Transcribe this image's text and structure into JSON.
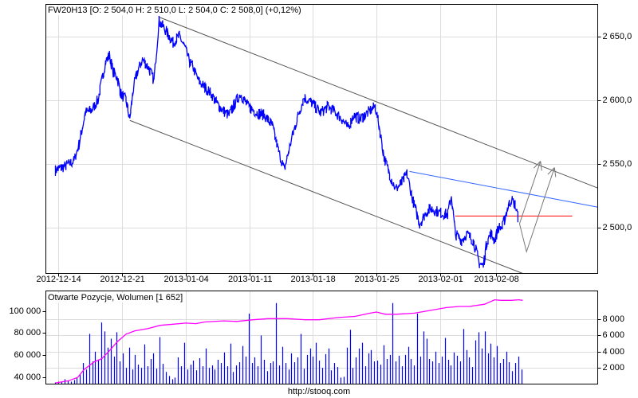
{
  "header": {
    "title": "FW20H13 [O: 2 504,0  H: 2 510,0  L: 2 504,0  C: 2 508,0] (+0,12%)"
  },
  "footer": {
    "url": "http://stooq.com"
  },
  "colors": {
    "price": "#0000ff",
    "trend": "#555555",
    "blue_trend": "#3366ff",
    "level": "#ff0000",
    "oi": "#ff00ff",
    "volume": "#0000ff",
    "grid": "#dddddd"
  },
  "chart_data": [
    {
      "type": "line",
      "title": "FW20H13",
      "x_unit": "session",
      "xlim": [
        0,
        43.4
      ],
      "ylim": [
        2464,
        2675
      ],
      "grid": true,
      "x_ticks": [
        {
          "x": 1,
          "label": "2012-12-14"
        },
        {
          "x": 6,
          "label": "2012-12-21"
        },
        {
          "x": 11,
          "label": "2013-01-04"
        },
        {
          "x": 16,
          "label": "2013-01-11"
        },
        {
          "x": 21,
          "label": "2013-01-18"
        },
        {
          "x": 26,
          "label": "2013-01-25"
        },
        {
          "x": 31,
          "label": "2013-02-01"
        },
        {
          "x": 35.4,
          "label": "2013-02-08"
        }
      ],
      "y_ticks": [
        {
          "y": 2650,
          "label": "2 650,0"
        },
        {
          "y": 2600,
          "label": "2 600,0"
        },
        {
          "y": 2550,
          "label": "2 550,0"
        },
        {
          "y": 2500,
          "label": "2 500,0"
        }
      ],
      "price": [
        [
          0.75,
          2545
        ],
        [
          1.5,
          2548
        ],
        [
          2.2,
          2552
        ],
        [
          2.6,
          2565
        ],
        [
          3.1,
          2590
        ],
        [
          3.6,
          2592
        ],
        [
          4.1,
          2600
        ],
        [
          4.4,
          2615
        ],
        [
          4.7,
          2630
        ],
        [
          5.0,
          2635
        ],
        [
          5.3,
          2622
        ],
        [
          5.6,
          2618
        ],
        [
          5.9,
          2605
        ],
        [
          6.3,
          2600
        ],
        [
          6.6,
          2585
        ],
        [
          6.9,
          2610
        ],
        [
          7.2,
          2622
        ],
        [
          7.6,
          2632
        ],
        [
          8.1,
          2625
        ],
        [
          8.5,
          2615
        ],
        [
          8.9,
          2662
        ],
        [
          9.4,
          2655
        ],
        [
          10,
          2645
        ],
        [
          10.5,
          2650
        ],
        [
          10.9,
          2642
        ],
        [
          11.3,
          2630
        ],
        [
          11.6,
          2625
        ],
        [
          12.0,
          2615
        ],
        [
          12.5,
          2610
        ],
        [
          13.0,
          2605
        ],
        [
          13.4,
          2598
        ],
        [
          13.9,
          2592
        ],
        [
          14.4,
          2588
        ],
        [
          14.9,
          2598
        ],
        [
          15.3,
          2605
        ],
        [
          15.9,
          2595
        ],
        [
          16.6,
          2590
        ],
        [
          17.2,
          2588
        ],
        [
          17.8,
          2580
        ],
        [
          18.3,
          2560
        ],
        [
          18.75,
          2545
        ],
        [
          19.1,
          2560
        ],
        [
          19.4,
          2572
        ],
        [
          19.9,
          2590
        ],
        [
          20.3,
          2602
        ],
        [
          20.9,
          2598
        ],
        [
          21.6,
          2590
        ],
        [
          22.2,
          2595
        ],
        [
          22.8,
          2590
        ],
        [
          23.3,
          2585
        ],
        [
          23.75,
          2578
        ],
        [
          24.2,
          2588
        ],
        [
          24.7,
          2585
        ],
        [
          25.3,
          2590
        ],
        [
          25.9,
          2595
        ],
        [
          26.2,
          2580
        ],
        [
          26.6,
          2555
        ],
        [
          27.1,
          2540
        ],
        [
          27.5,
          2530
        ],
        [
          28.0,
          2535
        ],
        [
          28.4,
          2542
        ],
        [
          28.9,
          2520
        ],
        [
          29.4,
          2503
        ],
        [
          29.9,
          2512
        ],
        [
          30.3,
          2515
        ],
        [
          30.9,
          2512
        ],
        [
          31.6,
          2510
        ],
        [
          31.9,
          2525
        ],
        [
          32.2,
          2495
        ],
        [
          32.7,
          2490
        ],
        [
          33.1,
          2495
        ],
        [
          33.6,
          2490
        ],
        [
          34.1,
          2472
        ],
        [
          34.4,
          2470
        ],
        [
          34.7,
          2490
        ],
        [
          35.0,
          2495
        ],
        [
          35.3,
          2490
        ],
        [
          35.6,
          2500
        ],
        [
          35.9,
          2500
        ],
        [
          36.3,
          2515
        ],
        [
          36.6,
          2522
        ],
        [
          36.9,
          2518
        ],
        [
          37.2,
          2505
        ]
      ],
      "trend_lines": [
        {
          "name": "upper-channel",
          "from": [
            8.9,
            2665
          ],
          "to": [
            43.4,
            2531
          ]
        },
        {
          "name": "lower-channel",
          "from": [
            6.6,
            2584
          ],
          "to": [
            37.5,
            2464
          ]
        },
        {
          "name": "blue-resistance",
          "from": [
            28.6,
            2544
          ],
          "to": [
            43.4,
            2516
          ]
        },
        {
          "name": "red-level",
          "from": [
            32.2,
            2509
          ],
          "to": [
            41.4,
            2509
          ]
        }
      ],
      "forecast_arrows": [
        [
          [
            37.25,
            2503
          ],
          [
            38.9,
            2552
          ]
        ],
        [
          [
            37.25,
            2503
          ],
          [
            37.8,
            2481
          ],
          [
            40.0,
            2547
          ]
        ]
      ]
    },
    {
      "type": "bar",
      "title": "Otwarte Pozycje, Wolumen [1 652]",
      "xlim": [
        0,
        43.4
      ],
      "x_start": 0.75,
      "x_end": 37.4,
      "y_left": {
        "label": "Otwarte Pozycje",
        "ylim": [
          34000,
          118000
        ],
        "ticks": [
          {
            "y": 100000,
            "label": "100 000"
          },
          {
            "y": 80000,
            "label": "80 000"
          },
          {
            "y": 60000,
            "label": "60 000"
          },
          {
            "y": 40000,
            "label": "40 000"
          }
        ]
      },
      "y_right": {
        "label": "Wolumen",
        "ylim": [
          0,
          11500
        ],
        "ticks": [
          {
            "y": 8000,
            "label": "8 000"
          },
          {
            "y": 6000,
            "label": "6 000"
          },
          {
            "y": 4000,
            "label": "4 000"
          },
          {
            "y": 2000,
            "label": "2 000"
          }
        ]
      },
      "volume": [
        200,
        300,
        250,
        600,
        400,
        300,
        500,
        800,
        1200,
        2600,
        1800,
        6200,
        2800,
        4000,
        3000,
        7600,
        6500,
        4500,
        5600,
        3400,
        6400,
        2800,
        3800,
        2000,
        4500,
        1800,
        3600,
        2400,
        2000,
        4900,
        2200,
        3100,
        3800,
        1900,
        5800,
        2500,
        1500,
        1000,
        600,
        800,
        3300,
        2200,
        5100,
        1800,
        2400,
        2900,
        1700,
        3200,
        2200,
        4400,
        2000,
        2300,
        1800,
        3000,
        2600,
        3900,
        2200,
        5000,
        1500,
        2300,
        2700,
        4700,
        3400,
        8700,
        2600,
        3300,
        2200,
        6000,
        3000,
        1600,
        2600,
        2800,
        10000,
        2300,
        4600,
        2600,
        1800,
        3800,
        2700,
        3300,
        6200,
        1900,
        3600,
        4400,
        3400,
        5100,
        2900,
        2000,
        3700,
        4400,
        1700,
        2600,
        2100,
        800,
        900,
        4500,
        6700,
        2000,
        3300,
        4400,
        5100,
        2200,
        3800,
        4200,
        2800,
        2900,
        2400,
        4800,
        3100,
        3600,
        10000,
        2800,
        3500,
        2200,
        3600,
        4600,
        3100,
        2300,
        8700,
        3400,
        6500,
        5600,
        3100,
        2800,
        4000,
        2600,
        3400,
        5700,
        3000,
        2300,
        3900,
        3500,
        2800,
        6800,
        4200,
        3300,
        2100,
        5400,
        6400,
        4400,
        6500,
        3800,
        5000,
        3300,
        4700,
        2600,
        3100,
        4000,
        2700,
        1600,
        2600,
        3400,
        1800
      ],
      "open_interest": [
        [
          0.75,
          35000
        ],
        [
          1.8,
          37000
        ],
        [
          2.5,
          40000
        ],
        [
          3.0,
          47000
        ],
        [
          3.8,
          54000
        ],
        [
          4.4,
          57000
        ],
        [
          5.0,
          64000
        ],
        [
          5.6,
          72000
        ],
        [
          6.3,
          79000
        ],
        [
          7.0,
          82000
        ],
        [
          8.0,
          84000
        ],
        [
          9.0,
          87000
        ],
        [
          10.0,
          88000
        ],
        [
          11.0,
          89000
        ],
        [
          11.8,
          88500
        ],
        [
          12.5,
          90000
        ],
        [
          14.0,
          91000
        ],
        [
          15.0,
          90500
        ],
        [
          16.3,
          92000
        ],
        [
          17.5,
          93000
        ],
        [
          19.0,
          93000
        ],
        [
          20.4,
          92000
        ],
        [
          21.5,
          92000
        ],
        [
          23.0,
          94000
        ],
        [
          24.3,
          95000
        ],
        [
          25.5,
          98000
        ],
        [
          26.0,
          99000
        ],
        [
          26.7,
          97000
        ],
        [
          27.5,
          97000
        ],
        [
          29.0,
          98000
        ],
        [
          30.0,
          100000
        ],
        [
          31.5,
          103000
        ],
        [
          32.5,
          104000
        ],
        [
          33.3,
          104000
        ],
        [
          34.5,
          106000
        ],
        [
          35.3,
          110000
        ],
        [
          35.8,
          109500
        ],
        [
          36.6,
          109500
        ],
        [
          37.2,
          110000
        ],
        [
          37.5,
          109500
        ]
      ]
    }
  ]
}
